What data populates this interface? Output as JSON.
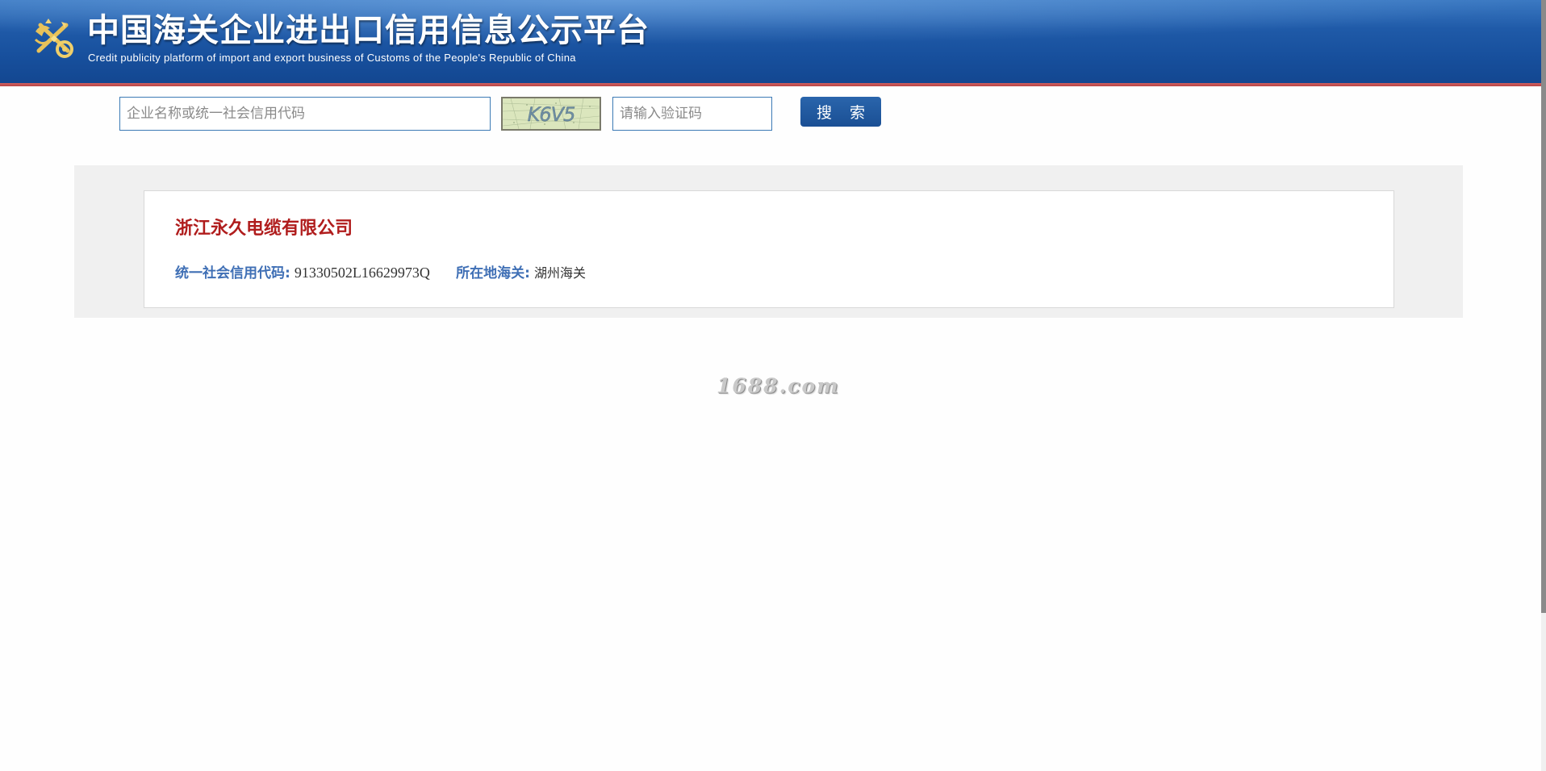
{
  "header": {
    "title": "中国海关企业进出口信用信息公示平台",
    "subtitle": "Credit publicity platform of import and export business of Customs of the People's Republic of China",
    "logo_icon": "customs-emblem-icon",
    "colors": {
      "banner": "#1f5aa8",
      "stripe": "#b84545",
      "title_text": "#ffffff"
    }
  },
  "search": {
    "company_placeholder": "企业名称或统一社会信用代码",
    "captcha_placeholder": "请输入验证码",
    "captcha_text": "K6V5",
    "button_label": "搜 索"
  },
  "result": {
    "company_name": "浙江永久电缆有限公司",
    "credit_code_label": "统一社会信用代码:",
    "credit_code_value": "91330502L16629973Q",
    "customs_label": "所在地海关:",
    "customs_value": "湖州海关",
    "colors": {
      "company_name": "#b01c1c",
      "label": "#3f6fb5"
    }
  },
  "watermark": "1688.com"
}
